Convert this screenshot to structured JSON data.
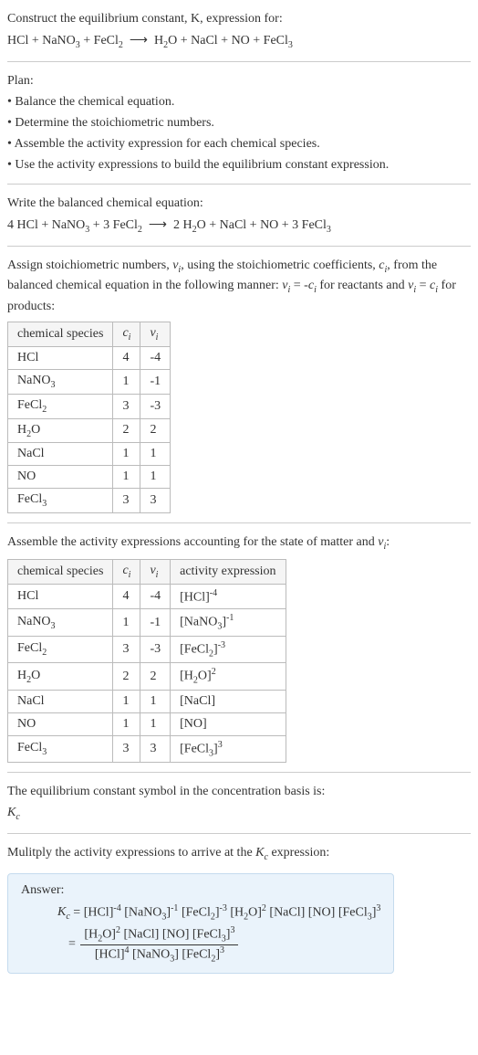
{
  "header": {
    "title": "Construct the equilibrium constant, K, expression for:",
    "equation_lhs": "HCl + NaNO₃ + FeCl₂",
    "equation_rhs": "H₂O + NaCl + NO + FeCl₃"
  },
  "plan": {
    "label": "Plan:",
    "items": [
      "Balance the chemical equation.",
      "Determine the stoichiometric numbers.",
      "Assemble the activity expression for each chemical species.",
      "Use the activity expressions to build the equilibrium constant expression."
    ]
  },
  "balanced": {
    "label": "Write the balanced chemical equation:",
    "lhs": "4 HCl + NaNO₃ + 3 FeCl₂",
    "rhs": "2 H₂O + NaCl + NO + 3 FeCl₃"
  },
  "stoich_intro": {
    "text_a": "Assign stoichiometric numbers, νᵢ, using the stoichiometric coefficients, cᵢ, from the balanced chemical equation in the following manner: νᵢ = -cᵢ for reactants and νᵢ = cᵢ for products:"
  },
  "table1": {
    "headers": [
      "chemical species",
      "cᵢ",
      "νᵢ"
    ],
    "rows": [
      [
        "HCl",
        "4",
        "-4"
      ],
      [
        "NaNO₃",
        "1",
        "-1"
      ],
      [
        "FeCl₂",
        "3",
        "-3"
      ],
      [
        "H₂O",
        "2",
        "2"
      ],
      [
        "NaCl",
        "1",
        "1"
      ],
      [
        "NO",
        "1",
        "1"
      ],
      [
        "FeCl₃",
        "3",
        "3"
      ]
    ]
  },
  "activity_intro": "Assemble the activity expressions accounting for the state of matter and νᵢ:",
  "table2": {
    "headers": [
      "chemical species",
      "cᵢ",
      "νᵢ",
      "activity expression"
    ],
    "rows": [
      {
        "sp": "HCl",
        "c": "4",
        "v": "-4",
        "expr_base": "[HCl]",
        "expr_sup": "-4"
      },
      {
        "sp": "NaNO₃",
        "c": "1",
        "v": "-1",
        "expr_base": "[NaNO₃]",
        "expr_sup": "-1"
      },
      {
        "sp": "FeCl₂",
        "c": "3",
        "v": "-3",
        "expr_base": "[FeCl₂]",
        "expr_sup": "-3"
      },
      {
        "sp": "H₂O",
        "c": "2",
        "v": "2",
        "expr_base": "[H₂O]",
        "expr_sup": "2"
      },
      {
        "sp": "NaCl",
        "c": "1",
        "v": "1",
        "expr_base": "[NaCl]",
        "expr_sup": ""
      },
      {
        "sp": "NO",
        "c": "1",
        "v": "1",
        "expr_base": "[NO]",
        "expr_sup": ""
      },
      {
        "sp": "FeCl₃",
        "c": "3",
        "v": "3",
        "expr_base": "[FeCl₃]",
        "expr_sup": "3"
      }
    ]
  },
  "kc_symbol": {
    "text": "The equilibrium constant symbol in the concentration basis is:",
    "symbol": "K_c"
  },
  "multiply_intro": "Mulitply the activity expressions to arrive at the K_c expression:",
  "answer": {
    "label": "Answer:",
    "line1_lhs": "K_c = ",
    "line1_rhs": "[HCl]⁻⁴ [NaNO₃]⁻¹ [FeCl₂]⁻³ [H₂O]² [NaCl] [NO] [FeCl₃]³",
    "frac_eq": "= ",
    "frac_num": "[H₂O]² [NaCl] [NO] [FeCl₃]³",
    "frac_den": "[HCl]⁴ [NaNO₃] [FeCl₂]³"
  }
}
